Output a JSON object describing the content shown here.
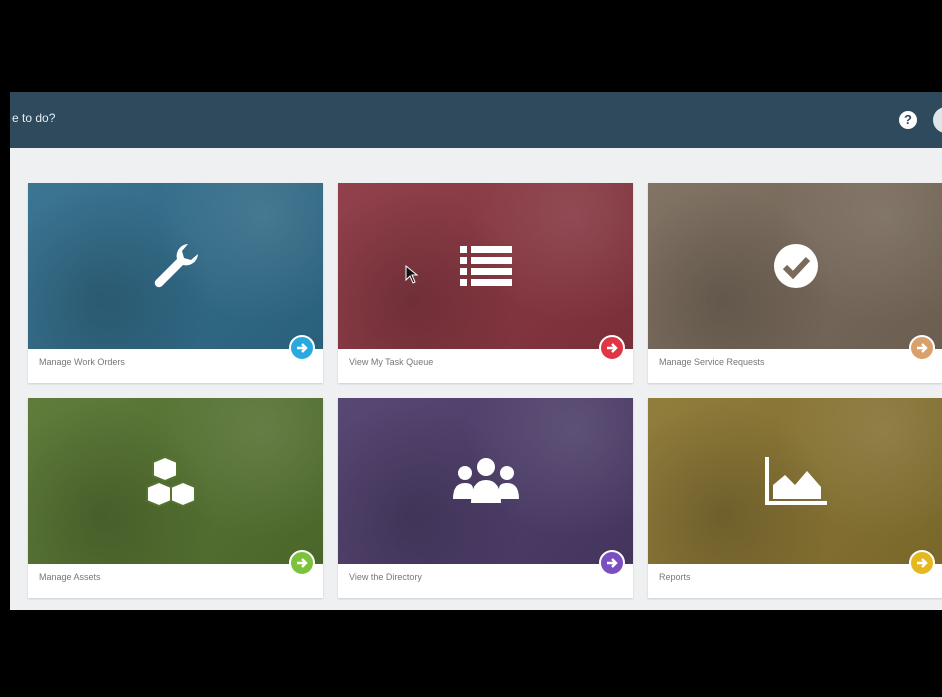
{
  "header": {
    "title": "e to do?",
    "help_label": "?"
  },
  "cards": [
    {
      "label": "Manage Work Orders",
      "color": "#2f6d8c",
      "accent": "#2aa9e0",
      "icon": "wrench-icon"
    },
    {
      "label": "View My Task Queue",
      "color": "#8b3540",
      "accent": "#e03545",
      "icon": "list-icon"
    },
    {
      "label": "Manage Service Requests",
      "color": "#7a6b5b",
      "accent": "#d9a06b",
      "icon": "check-circle-icon"
    },
    {
      "label": "Manage Assets",
      "color": "#55742f",
      "accent": "#7cc23a",
      "icon": "cubes-icon"
    },
    {
      "label": "View the Directory",
      "color": "#4d3c6b",
      "accent": "#7a4fc0",
      "icon": "users-icon"
    },
    {
      "label": "Reports",
      "color": "#8a7530",
      "accent": "#e6b820",
      "icon": "area-chart-icon"
    }
  ]
}
